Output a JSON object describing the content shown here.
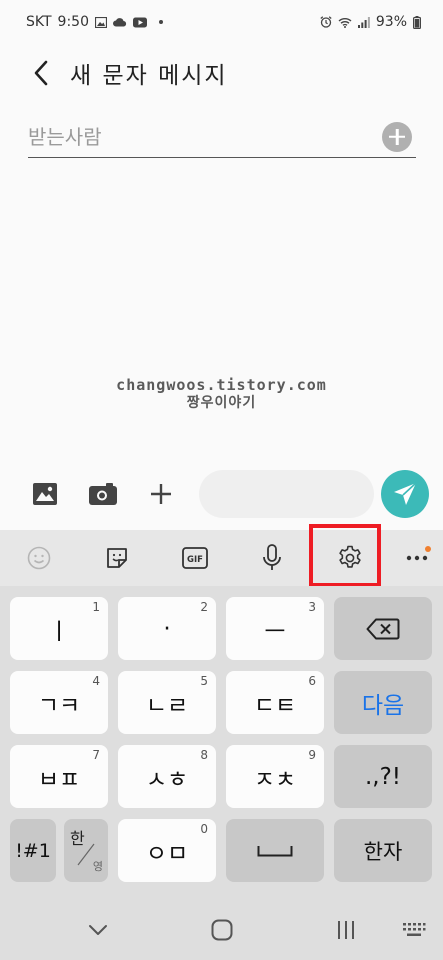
{
  "status": {
    "carrier": "SKT",
    "time": "9:50",
    "battery": "93%"
  },
  "header": {
    "title": "새 문자 메시지"
  },
  "recipient": {
    "placeholder": "받는사람"
  },
  "watermark": {
    "line1": "changwoos.tistory.com",
    "line2": "짱우이야기"
  },
  "keyboard": {
    "rows": [
      [
        {
          "label": "ㅣ",
          "num": "1"
        },
        {
          "label": "·",
          "num": "2"
        },
        {
          "label": "ㅡ",
          "num": "3"
        }
      ],
      [
        {
          "label": "ㄱㅋ",
          "num": "4"
        },
        {
          "label": "ㄴㄹ",
          "num": "5"
        },
        {
          "label": "ㄷㅌ",
          "num": "6"
        }
      ],
      [
        {
          "label": "ㅂㅍ",
          "num": "7"
        },
        {
          "label": "ㅅㅎ",
          "num": "8"
        },
        {
          "label": "ㅈㅊ",
          "num": "9"
        }
      ]
    ],
    "next_label": "다음",
    "punct_label": ".,?!",
    "symbols_label": "!#1",
    "lang_top": "한",
    "lang_bottom": "영",
    "zero_key": {
      "label": "ㅇㅁ",
      "num": "0"
    },
    "hanja_label": "한자",
    "accent_color": "#1a73e8"
  },
  "colors": {
    "send_button": "#3cbab8",
    "highlight": "#ee1c24"
  }
}
